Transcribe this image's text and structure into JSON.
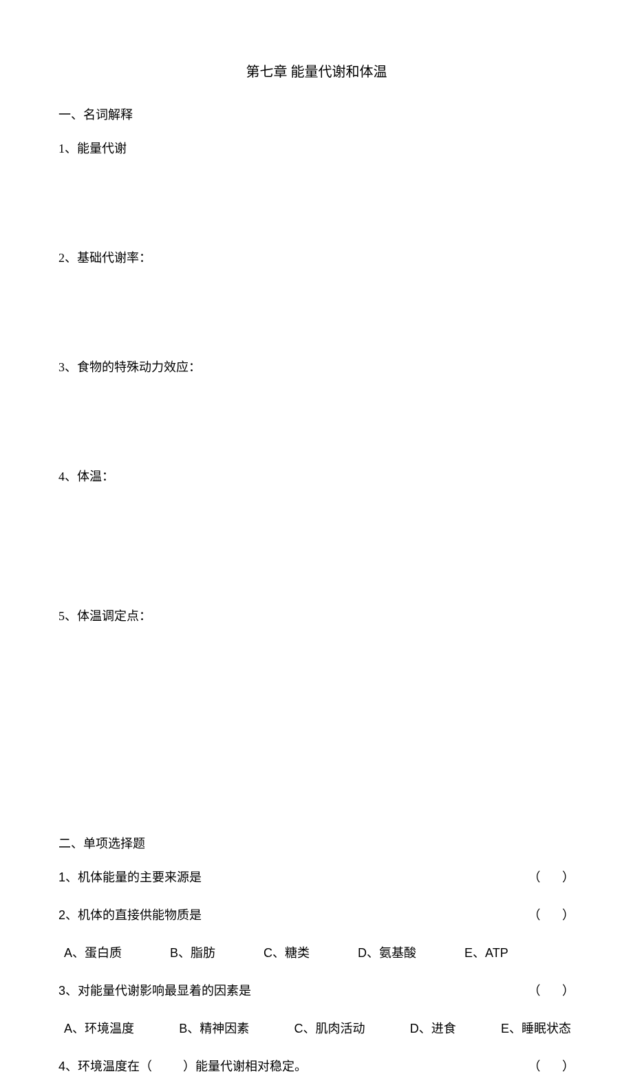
{
  "title": "第七章      能量代谢和体温",
  "section1_heading": "一、名词解释",
  "terms": [
    "1、能量代谢",
    "2、基础代谢率：",
    "3、食物的特殊动力效应：",
    "4、体温：",
    "5、体温调定点："
  ],
  "section2_heading": "二、单项选择题",
  "q1": {
    "num": "1",
    "stem": "、机体能量的主要来源是",
    "paren": "（       ）"
  },
  "q2": {
    "num": "2",
    "stem": "、机体的直接供能物质是",
    "paren": "（       ）"
  },
  "opts_shared": {
    "a_l": "A",
    "a_t": "、蛋白质",
    "b_l": "B",
    "b_t": "、脂肪",
    "c_l": "C",
    "c_t": "、糖类",
    "d_l": "D",
    "d_t": "、氨基酸",
    "e_l": "E",
    "e_t": "、",
    "e_val": "ATP"
  },
  "q3": {
    "num": "3",
    "stem": "、对能量代谢影响最显着的因素是",
    "paren": "（       ）",
    "opts": {
      "a_l": "A",
      "a_t": "、环境温度",
      "b_l": "B",
      "b_t": "、精神因素",
      "c_l": "C",
      "c_t": "、肌肉活动",
      "d_l": "D",
      "d_t": "、进食",
      "e_l": "E",
      "e_t": "、睡眠状态"
    }
  },
  "q4": {
    "num": "4",
    "stem_before": "、环境温度在（",
    "stem_after": "）能量代谢相对稳定。",
    "blank": "          ",
    "paren": "（       ）"
  }
}
